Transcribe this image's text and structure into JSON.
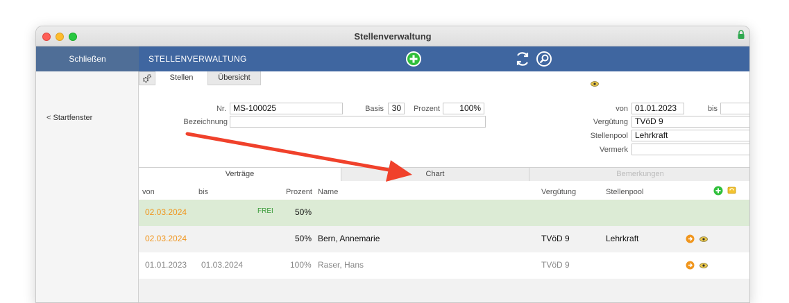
{
  "window": {
    "title": "Stellenverwaltung"
  },
  "toolbar": {
    "close_label": "Schließen",
    "app_title": "STELLENVERWALTUNG"
  },
  "sidebar": {
    "start_link": "< Startfenster"
  },
  "tabs_top": {
    "stellen": "Stellen",
    "uebersicht": "Übersicht"
  },
  "form": {
    "nr_label": "Nr.",
    "nr_value": "MS-100025",
    "basis_label": "Basis",
    "basis_value": "30",
    "prozent_label": "Prozent",
    "prozent_value": "100%",
    "bezeichnung_label": "Bezeichnung",
    "bezeichnung_value": "",
    "von_label": "von",
    "von_value": "01.01.2023",
    "bis_label": "bis",
    "bis_value": "",
    "verguetung_label": "Vergütung",
    "verguetung_value": "TVöD 9",
    "stellenpool_label": "Stellenpool",
    "stellenpool_value": "Lehrkraft",
    "vermerk_label": "Vermerk",
    "vermerk_value": ""
  },
  "lower_tabs": {
    "vertraege": "Verträge",
    "chart": "Chart",
    "bemerkungen": "Bemerkungen"
  },
  "table": {
    "headers": {
      "von": "von",
      "bis": "bis",
      "prozent": "Prozent",
      "name": "Name",
      "verguetung": "Vergütung",
      "stellenpool": "Stellenpool"
    },
    "rows": [
      {
        "von": "02.03.2024",
        "bis": "",
        "frei": "FREI",
        "prozent": "50%",
        "name": "",
        "verguetung": "",
        "stellenpool": ""
      },
      {
        "von": "02.03.2024",
        "bis": "",
        "frei": "",
        "prozent": "50%",
        "name": "Bern, Annemarie",
        "verguetung": "TVöD 9",
        "stellenpool": "Lehrkraft"
      },
      {
        "von": "01.01.2023",
        "bis": "01.03.2024",
        "frei": "",
        "prozent": "100%",
        "name": "Raser, Hans",
        "verguetung": "TVöD 9",
        "stellenpool": ""
      }
    ]
  },
  "colors": {
    "toolbar": "#3f66a0",
    "close_button": "#4f6e97",
    "orange_date": "#f0961e",
    "free_row": "#dcebd5",
    "annotation_arrow": "#f0412b"
  },
  "icons": [
    "lock-icon",
    "add-circle-icon",
    "refresh-icon",
    "search-icon",
    "gear-icon",
    "eye-icon",
    "arrow-right-circle-icon",
    "folder-icon"
  ]
}
